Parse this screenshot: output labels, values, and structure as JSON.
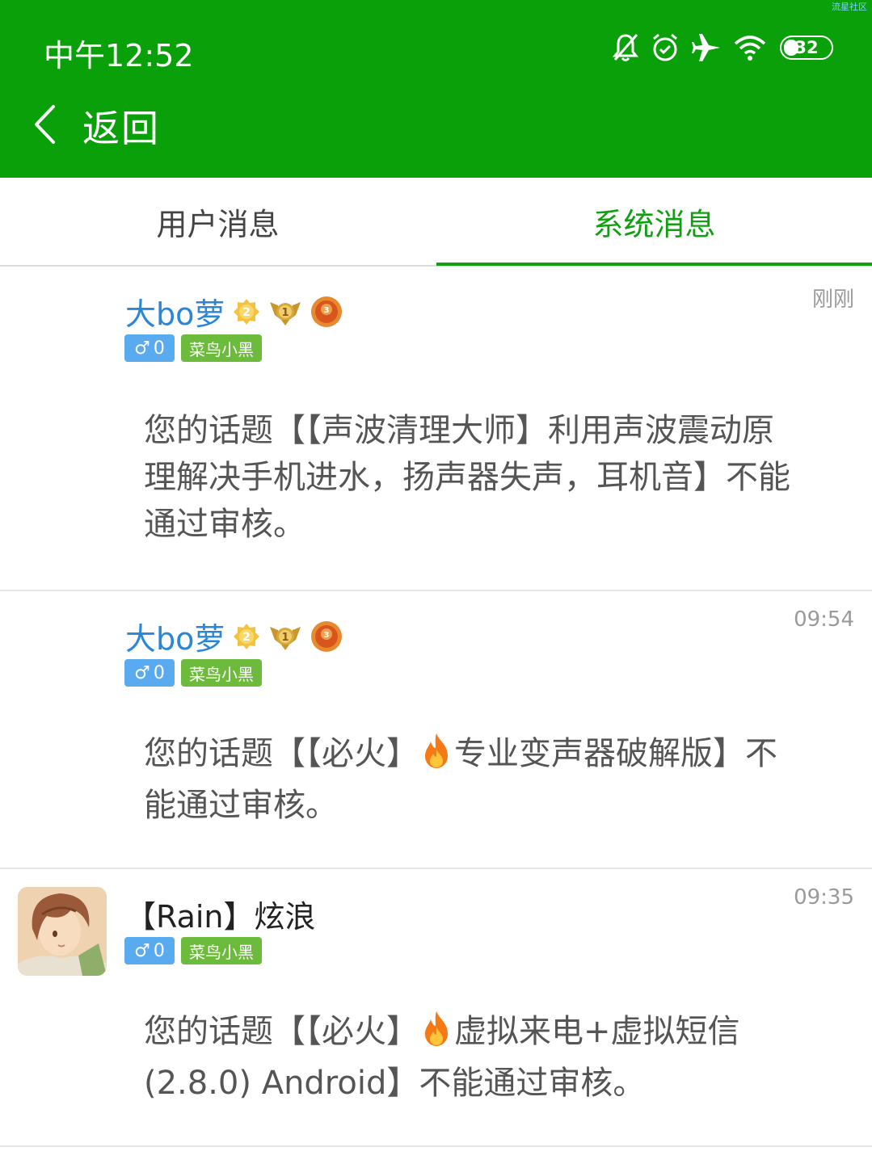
{
  "header": {
    "watermark": "流星社区",
    "time": "中午12:52",
    "battery": "32",
    "back_label": "返回",
    "status_icons": [
      "bell-muted-icon",
      "alarm-icon",
      "airplane-icon",
      "wifi-icon",
      "battery-icon"
    ]
  },
  "tabs": [
    {
      "label": "用户消息",
      "active": false
    },
    {
      "label": "系统消息",
      "active": true
    }
  ],
  "messages": [
    {
      "username": "大bo萝",
      "badges": [
        "level-2-badge-icon",
        "rank-1-wings-icon",
        "medal-3-icon"
      ],
      "gender": "♂",
      "gender_count": "0",
      "level": "菜鸟小黑",
      "time": "刚刚",
      "content": "您的话题【【声波清理大师】利用声波震动原理解决手机进水，扬声器失声，耳机音】不能通过审核。",
      "line1": "您的话题【【声波清理大师】利用声波震动原",
      "line2": "理解决手机进水，扬声器失声，耳机音】不能",
      "line3": "通过审核。"
    },
    {
      "username": "大bo萝",
      "badges": [
        "level-2-badge-icon",
        "rank-1-wings-icon",
        "medal-3-icon"
      ],
      "gender": "♂",
      "gender_count": "0",
      "level": "菜鸟小黑",
      "time": "09:54",
      "content_pre": "您的话题【【必火】",
      "content_post": "专业变声器破解版】不",
      "content_line2": "能通过审核。"
    },
    {
      "username": "【Rain】炫浪",
      "gender": "♂",
      "gender_count": "0",
      "level": "菜鸟小黑",
      "time": "09:35",
      "content_pre": "您的话题【【必火】",
      "content_post": "虚拟来电+虚拟短信",
      "content_line2": "(2.8.0) Android】不能通过审核。"
    }
  ],
  "colors": {
    "header_bg": "#0aa00a",
    "active_tab": "#11a011",
    "username": "#2a86d6",
    "gender_tag": "#5aaaf0",
    "level_tag": "#6cbb3c"
  }
}
